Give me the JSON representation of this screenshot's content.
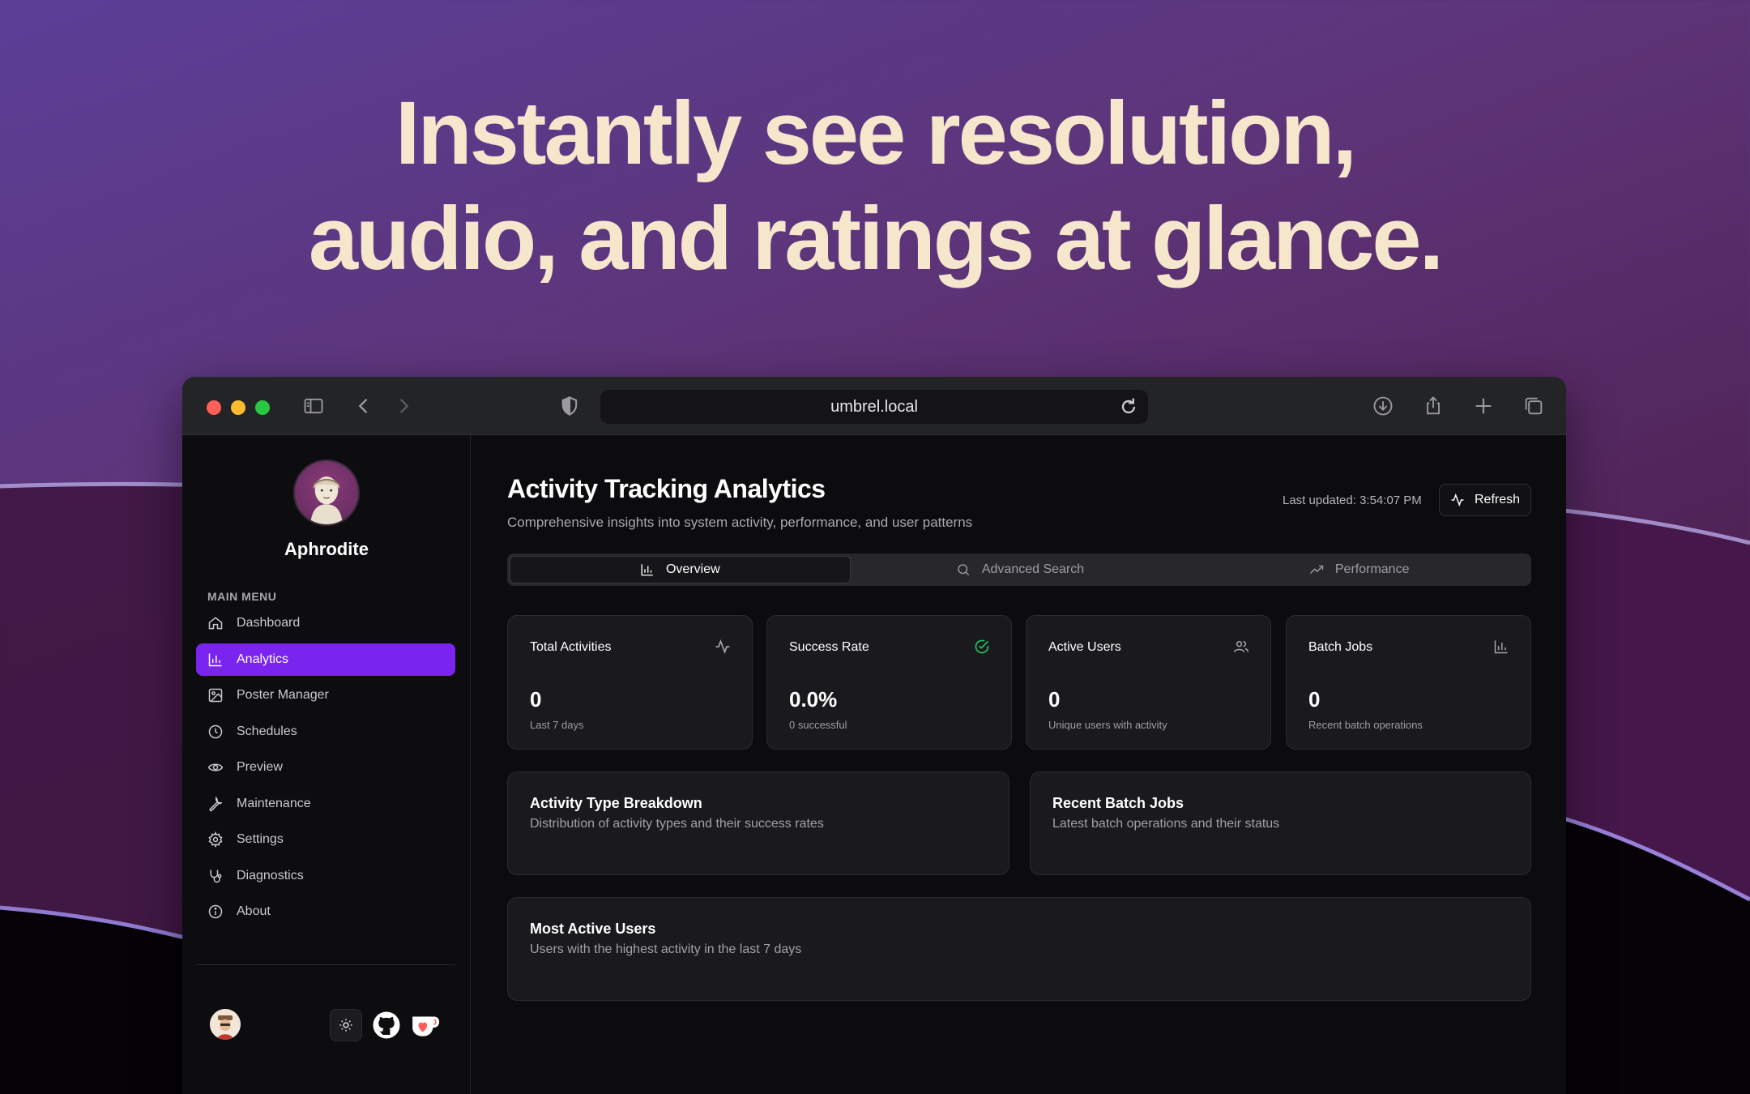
{
  "headline": {
    "line1": "Instantly see resolution,",
    "line2": "audio, and ratings at glance."
  },
  "browser": {
    "url": "umbrel.local"
  },
  "sidebar": {
    "app_name": "Aphrodite",
    "menu_title": "MAIN MENU",
    "items": [
      {
        "label": "Dashboard",
        "icon": "home-icon",
        "active": false
      },
      {
        "label": "Analytics",
        "icon": "bar-chart-icon",
        "active": true
      },
      {
        "label": "Poster Manager",
        "icon": "image-icon",
        "active": false
      },
      {
        "label": "Schedules",
        "icon": "clock-icon",
        "active": false
      },
      {
        "label": "Preview",
        "icon": "eye-icon",
        "active": false
      },
      {
        "label": "Maintenance",
        "icon": "wrench-icon",
        "active": false
      },
      {
        "label": "Settings",
        "icon": "gear-icon",
        "active": false
      },
      {
        "label": "Diagnostics",
        "icon": "stethoscope-icon",
        "active": false
      },
      {
        "label": "About",
        "icon": "info-icon",
        "active": false
      }
    ]
  },
  "main": {
    "title": "Activity Tracking Analytics",
    "subtitle": "Comprehensive insights into system activity, performance, and user patterns",
    "last_updated": "Last updated: 3:54:07 PM",
    "refresh_label": "Refresh",
    "tabs": [
      {
        "label": "Overview",
        "icon": "bar-chart-icon",
        "active": true
      },
      {
        "label": "Advanced Search",
        "icon": "search-icon",
        "active": false
      },
      {
        "label": "Performance",
        "icon": "trending-up-icon",
        "active": false
      }
    ],
    "stats": [
      {
        "label": "Total Activities",
        "value": "0",
        "sub": "Last 7 days",
        "icon": "activity-icon"
      },
      {
        "label": "Success Rate",
        "value": "0.0%",
        "sub": "0 successful",
        "icon": "check-circle-icon"
      },
      {
        "label": "Active Users",
        "value": "0",
        "sub": "Unique users with activity",
        "icon": "users-icon"
      },
      {
        "label": "Batch Jobs",
        "value": "0",
        "sub": "Recent batch operations",
        "icon": "bar-chart-icon"
      }
    ],
    "panels": {
      "breakdown": {
        "title": "Activity Type Breakdown",
        "subtitle": "Distribution of activity types and their success rates"
      },
      "batch": {
        "title": "Recent Batch Jobs",
        "subtitle": "Latest batch operations and their status"
      },
      "users": {
        "title": "Most Active Users",
        "subtitle": "Users with the highest activity in the last 7 days"
      }
    }
  },
  "colors": {
    "accent": "#7a24f0",
    "headline": "#f5e6cc",
    "success": "#22c55e"
  }
}
